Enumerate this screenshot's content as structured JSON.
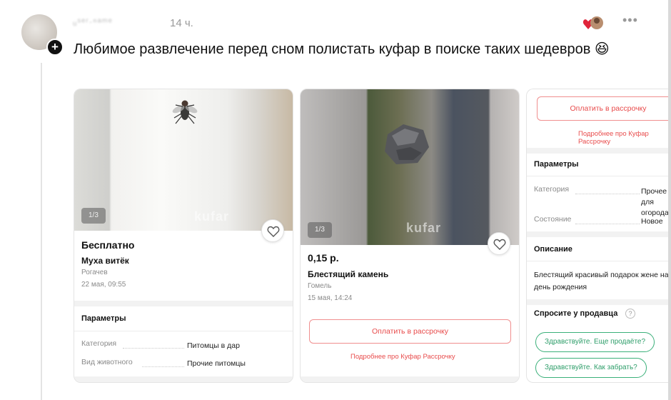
{
  "post": {
    "username": "ᵤˢᵉʳ·ⁿᵃᵐᵉ",
    "time": "14 ч.",
    "text": "Любимое развлечение перед сном полистать куфар в поиске таких шедевров 😆"
  },
  "cards": [
    {
      "photo_counter": "1/3",
      "watermark": "kufar",
      "price": "Бесплатно",
      "title": "Муха витёк",
      "city": "Рогачев",
      "date": "22 мая, 09:55",
      "params_title": "Параметры",
      "params": [
        {
          "key": "Категория",
          "value": "Питомцы в дар"
        },
        {
          "key": "Вид животного",
          "value": "Прочие питомцы"
        }
      ]
    },
    {
      "photo_counter": "1/3",
      "watermark": "kufar",
      "price": "0,15 р.",
      "title": "Блестящий камень",
      "city": "Гомель",
      "date": "15 мая, 14:24",
      "installment_button": "Оплатить в рассрочку",
      "installment_link": "Подробнее про Куфар Рассрочку"
    },
    {
      "installment_button": "Оплатить в рассрочку",
      "installment_link": "Подробнее про Куфар Рассрочку",
      "params_title": "Параметры",
      "params": [
        {
          "key": "Категория",
          "value": "Прочее для огорода"
        },
        {
          "key": "Состояние",
          "value": "Новое"
        }
      ],
      "description_title": "Описание",
      "description": "Блестящий красивый подарок жене на день рождения",
      "ask_title": "Спросите у продавца",
      "chips": [
        "Здравствуйте. Еще продаёте?",
        "Здравствуйте. Как забрать?"
      ]
    }
  ],
  "colors": {
    "accent_red": "#e84b4b",
    "accent_green": "#2e9e6a"
  },
  "icons": [
    "plus-icon",
    "reaction-heart-icon",
    "more-icon",
    "heart-icon",
    "help-icon"
  ]
}
